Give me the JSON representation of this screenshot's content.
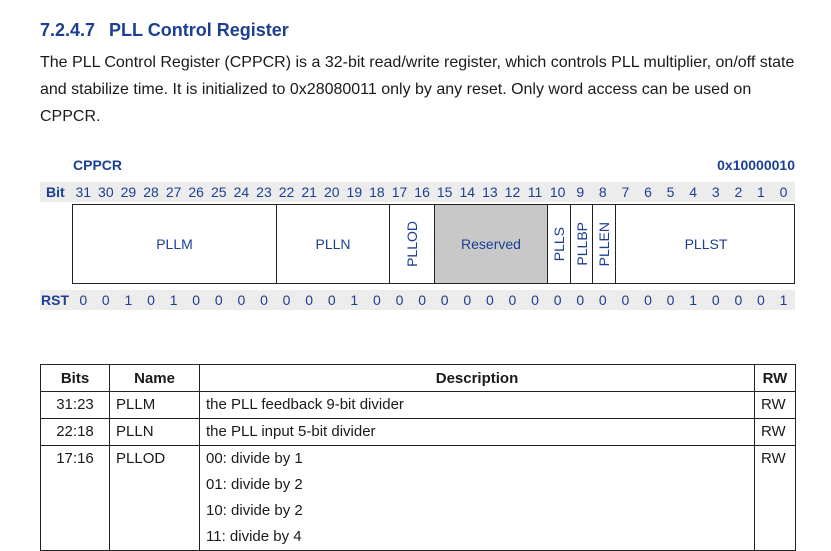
{
  "section": {
    "number": "7.2.4.7",
    "title": "PLL Control Register"
  },
  "paragraph": "The PLL Control Register (CPPCR) is a 32-bit read/write register, which controls PLL multiplier, on/off state and stabilize time. It is initialized to 0x28080011 only by any reset. Only word access can be used on CPPCR.",
  "register": {
    "name": "CPPCR",
    "address": "0x10000010",
    "bit_label": "Bit",
    "rst_label": "RST",
    "bits": [
      "31",
      "30",
      "29",
      "28",
      "27",
      "26",
      "25",
      "24",
      "23",
      "22",
      "21",
      "20",
      "19",
      "18",
      "17",
      "16",
      "15",
      "14",
      "13",
      "12",
      "11",
      "10",
      "9",
      "8",
      "7",
      "6",
      "5",
      "4",
      "3",
      "2",
      "1",
      "0"
    ],
    "reset": [
      "0",
      "0",
      "1",
      "0",
      "1",
      "0",
      "0",
      "0",
      "0",
      "0",
      "0",
      "0",
      "1",
      "0",
      "0",
      "0",
      "0",
      "0",
      "0",
      "0",
      "0",
      "0",
      "0",
      "0",
      "0",
      "0",
      "0",
      "1",
      "0",
      "0",
      "0",
      "1"
    ],
    "fields": [
      {
        "label": "PLLM",
        "orientation": "horizontal"
      },
      {
        "label": "PLLN",
        "orientation": "horizontal"
      },
      {
        "label": "PLLOD",
        "orientation": "vertical"
      },
      {
        "label": "Reserved",
        "orientation": "horizontal",
        "reserved": true
      },
      {
        "label": "PLLS",
        "orientation": "vertical"
      },
      {
        "label": "PLLBP",
        "orientation": "vertical"
      },
      {
        "label": "PLLEN",
        "orientation": "vertical"
      },
      {
        "label": "PLLST",
        "orientation": "horizontal"
      }
    ]
  },
  "table": {
    "headers": {
      "bits": "Bits",
      "name": "Name",
      "description": "Description",
      "rw": "RW"
    },
    "rows": [
      {
        "bits": "31:23",
        "name": "PLLM",
        "description": [
          "the PLL feedback 9-bit divider"
        ],
        "rw": "RW"
      },
      {
        "bits": "22:18",
        "name": "PLLN",
        "description": [
          "the PLL input  5-bit divider"
        ],
        "rw": "RW"
      },
      {
        "bits": "17:16",
        "name": "PLLOD",
        "description": [
          "00: divide by 1",
          "01: divide by 2",
          "10: divide by 2",
          "11: divide by 4"
        ],
        "rw": "RW"
      }
    ]
  }
}
